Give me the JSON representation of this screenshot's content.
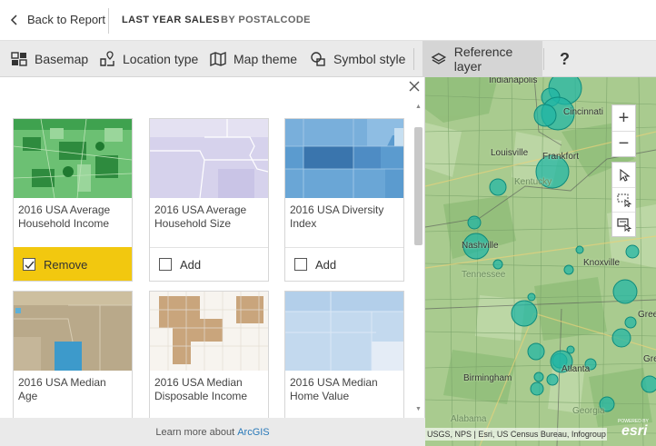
{
  "header": {
    "back_label": "Back to Report",
    "tabs": [
      "LAST YEAR SALES",
      "BY POSTALCODE"
    ]
  },
  "toolbar": {
    "items": [
      {
        "label": "Basemap",
        "icon": "grid-map-icon"
      },
      {
        "label": "Location type",
        "icon": "location-pin-icon"
      },
      {
        "label": "Map theme",
        "icon": "folded-map-icon"
      },
      {
        "label": "Symbol style",
        "icon": "shapes-icon"
      },
      {
        "label": "Reference layer",
        "icon": "layers-icon",
        "active": true
      }
    ],
    "help_label": "?"
  },
  "panel": {
    "cards": [
      {
        "title": "2016 USA Average Household Income",
        "action": "Remove",
        "selected": true
      },
      {
        "title": "2016 USA Average Household Size",
        "action": "Add",
        "selected": false
      },
      {
        "title": "2016 USA Diversity Index",
        "action": "Add",
        "selected": false
      },
      {
        "title": "2016 USA Median Age"
      },
      {
        "title": "2016 USA Median Disposable Income"
      },
      {
        "title": "2016 USA Median Home Value"
      }
    ],
    "footer_text": "Learn more about",
    "footer_link": "ArcGIS"
  },
  "map": {
    "cities": [
      "Indianapolis",
      "Cincinnati",
      "Louisville",
      "Frankfort",
      "Kentucky",
      "Nashville",
      "Tennessee",
      "Knoxville",
      "Greenville",
      "Birmingham",
      "Atlanta",
      "Alabama",
      "Georgia",
      "Gree"
    ],
    "attribution": "USGS, NPS | Esri, US Census Bureau, Infogroup",
    "logo_text": "esri",
    "logo_sub": "POWERED BY",
    "zoom_in": "+",
    "zoom_out": "−"
  },
  "colors": {
    "accent_yellow": "#f2c80f",
    "bubble_teal": "#1fb5a5",
    "link_blue": "#2a7ab9"
  }
}
